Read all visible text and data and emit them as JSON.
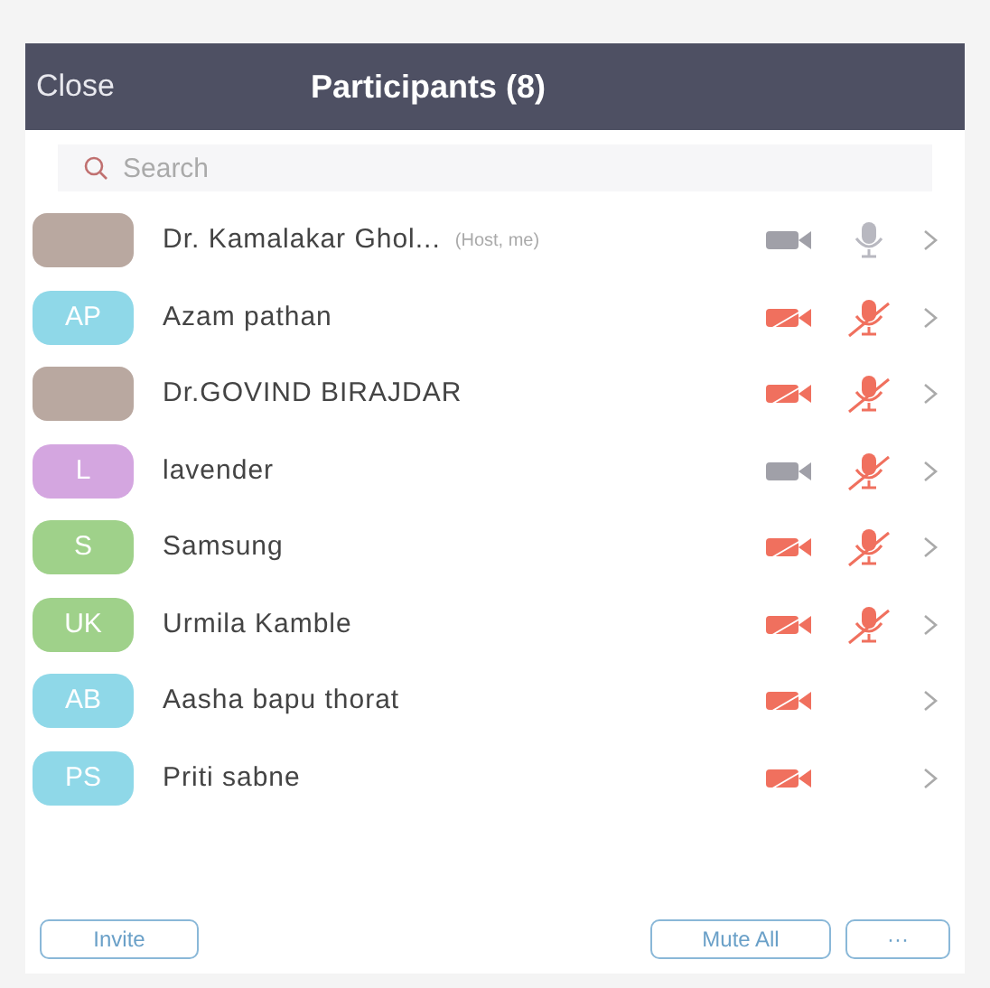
{
  "header": {
    "close": "Close",
    "title": "Participants (8)"
  },
  "search": {
    "placeholder": "Search"
  },
  "participants": [
    {
      "name": "Dr. Kamalakar Ghol...",
      "tag": "(Host, me)",
      "kind": "photo",
      "video_on": true,
      "mic": true,
      "muted": false
    },
    {
      "name": "Azam pathan",
      "kind": "initials",
      "initials": "AP",
      "color": "#8fd8e8",
      "video_on": false,
      "mic": true,
      "muted": true
    },
    {
      "name": "Dr.GOVIND BIRAJDAR",
      "kind": "photo",
      "video_on": false,
      "mic": true,
      "muted": true
    },
    {
      "name": "lavender",
      "kind": "initials",
      "initials": "L",
      "color": "#d4a6e0",
      "video_on": true,
      "mic": true,
      "muted": true
    },
    {
      "name": "Samsung",
      "kind": "initials",
      "initials": "S",
      "color": "#9fd18a",
      "video_on": false,
      "mic": true,
      "muted": true
    },
    {
      "name": "Urmila Kamble",
      "kind": "initials",
      "initials": "UK",
      "color": "#9fd18a",
      "video_on": false,
      "mic": true,
      "muted": true
    },
    {
      "name": "Aasha bapu thorat",
      "kind": "initials",
      "initials": "AB",
      "color": "#8fd8e8",
      "video_on": false,
      "mic": false
    },
    {
      "name": "Priti sabne",
      "kind": "initials",
      "initials": "PS",
      "color": "#8fd8e8",
      "video_on": false,
      "mic": false
    }
  ],
  "footer": {
    "invite": "Invite",
    "mute_all": "Mute All",
    "more": "···"
  }
}
